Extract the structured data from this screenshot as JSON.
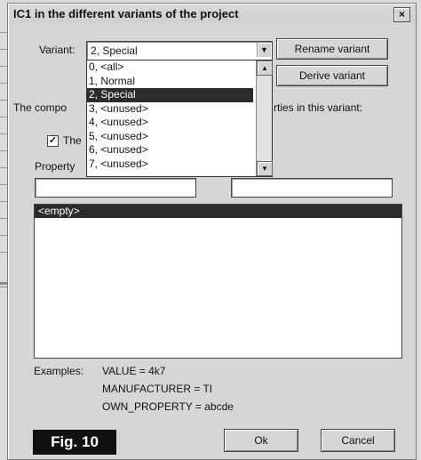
{
  "dialog": {
    "title": "IC1 in the different variants of the project",
    "close_label": "×",
    "variant_label": "Variant:",
    "variant_value": "2, Special",
    "rename_button": "Rename variant",
    "derive_button": "Derive variant",
    "dropdown_items": [
      "0, <all>",
      "1, Normal",
      "2, Special",
      "3, <unused>",
      "4, <unused>",
      "5, <unused>",
      "6, <unused>",
      "7, <unused>"
    ],
    "selected_index": 2,
    "component_text_left": "The compo",
    "component_text_right": "rties in this variant:",
    "checkbox_label": "The",
    "checkbox_mark": "✓",
    "property_label": "Property",
    "list_first_item": "<empty>",
    "examples_label": "Examples:",
    "examples": [
      "VALUE = 4k7",
      "MANUFACTURER = TI",
      "OWN_PROPERTY = abcde"
    ],
    "ok_button": "Ok",
    "cancel_button": "Cancel",
    "figure_label": "Fig. 10"
  }
}
